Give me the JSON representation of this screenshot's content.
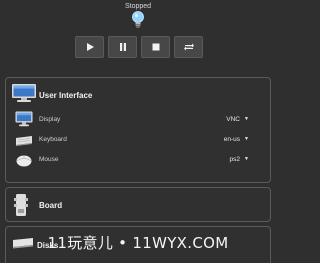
{
  "status": {
    "text": "Stopped"
  },
  "controls": [
    {
      "name": "play-button",
      "icon": "play-icon"
    },
    {
      "name": "pause-button",
      "icon": "pause-icon"
    },
    {
      "name": "stop-button",
      "icon": "stop-icon"
    },
    {
      "name": "restart-button",
      "icon": "loop-icon"
    }
  ],
  "user_interface": {
    "title": "User Interface",
    "rows": [
      {
        "label": "Display",
        "value": "VNC",
        "icon": "monitor-icon"
      },
      {
        "label": "Keyboard",
        "value": "en-us",
        "icon": "keyboard-icon"
      },
      {
        "label": "Mouse",
        "value": "ps2",
        "icon": "mouse-icon"
      }
    ]
  },
  "board": {
    "title": "Board",
    "icon": "board-icon"
  },
  "disks": {
    "title": "Disks",
    "icon": "disk-icon"
  },
  "watermark": {
    "text": "11玩意儿 • 11WYX.COM"
  },
  "colors": {
    "background": "#2f2f2f",
    "panel_border": "#5b5b5b",
    "button": "#474747"
  }
}
